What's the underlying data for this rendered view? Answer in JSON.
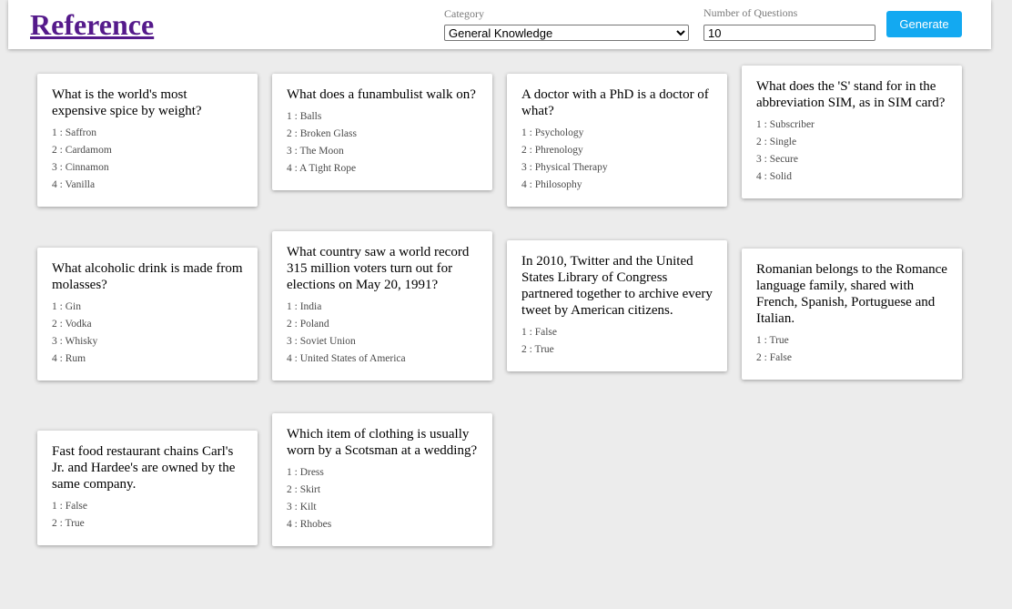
{
  "header": {
    "brand": "Reference",
    "category_label": "Category",
    "category_value": "General Knowledge",
    "questions_label": "Number of Questions",
    "questions_value": "10",
    "generate_label": "Generate"
  },
  "cards": [
    {
      "question": "What is the world's most expensive spice by weight?",
      "options": [
        "1 : Saffron",
        "2 : Cardamom",
        "3 : Cinnamon",
        "4 : Vanilla"
      ]
    },
    {
      "question": "What does a funambulist walk on?",
      "options": [
        "1 : Balls",
        "2 : Broken Glass",
        "3 : The Moon",
        "4 : A Tight Rope"
      ]
    },
    {
      "question": "A doctor with a PhD is a doctor of what?",
      "options": [
        "1 : Psychology",
        "2 : Phrenology",
        "3 : Physical Therapy",
        "4 : Philosophy"
      ]
    },
    {
      "question": "What does the 'S' stand for in the abbreviation SIM, as in SIM card?",
      "options": [
        "1 : Subscriber",
        "2 : Single",
        "3 : Secure",
        "4 : Solid"
      ]
    },
    {
      "question": "What alcoholic drink is made from molasses?",
      "options": [
        "1 : Gin",
        "2 : Vodka",
        "3 : Whisky",
        "4 : Rum"
      ]
    },
    {
      "question": "What country saw a world record 315 million voters turn out for elections on May 20, 1991?",
      "options": [
        "1 : India",
        "2 : Poland",
        "3 : Soviet Union",
        "4 : United States of America"
      ]
    },
    {
      "question": "In 2010, Twitter and the United States Library of Congress partnered together to archive every tweet by American citizens.",
      "options": [
        "1 : False",
        "2 : True"
      ]
    },
    {
      "question": "Romanian belongs to the Romance language family, shared with French, Spanish, Portuguese and Italian.",
      "options": [
        "1 : True",
        "2 : False"
      ]
    },
    {
      "question": "Fast food restaurant chains Carl's Jr. and Hardee's are owned by the same company.",
      "options": [
        "1 : False",
        "2 : True"
      ]
    },
    {
      "question": "Which item of clothing is usually worn by a Scotsman at a wedding?",
      "options": [
        "1 : Dress",
        "2 : Skirt",
        "3 : Kilt",
        "4 : Rhobes"
      ]
    }
  ]
}
